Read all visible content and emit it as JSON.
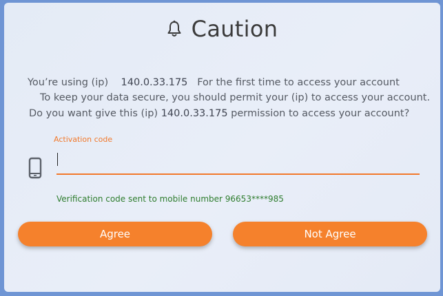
{
  "dialog": {
    "title": "Caution",
    "message": {
      "line1_prefix": "You’re using (ip)",
      "line1_ip": "140.0.33.175",
      "line1_suffix": "For the first time to access your account",
      "line2": "To keep your data secure, you should permit your (ip) to access your account.",
      "line3_prefix": "Do you want give this (ip)",
      "line3_ip": "140.0.33.175",
      "line3_suffix": "permission to access your account?"
    },
    "activation_field": {
      "label": "Activation code",
      "value": ""
    },
    "verification_note": "Verification code sent to mobile number 96653****985",
    "buttons": {
      "agree": "Agree",
      "not_agree": "Not Agree"
    }
  },
  "icons": {
    "title_icon": "bell-icon",
    "field_icon": "mobile-phone-icon"
  },
  "colors": {
    "accent": "#f5812c",
    "note_text": "#2e7d2e",
    "page_background": "#6f95d4",
    "dialog_background": "#e6ecf7"
  }
}
